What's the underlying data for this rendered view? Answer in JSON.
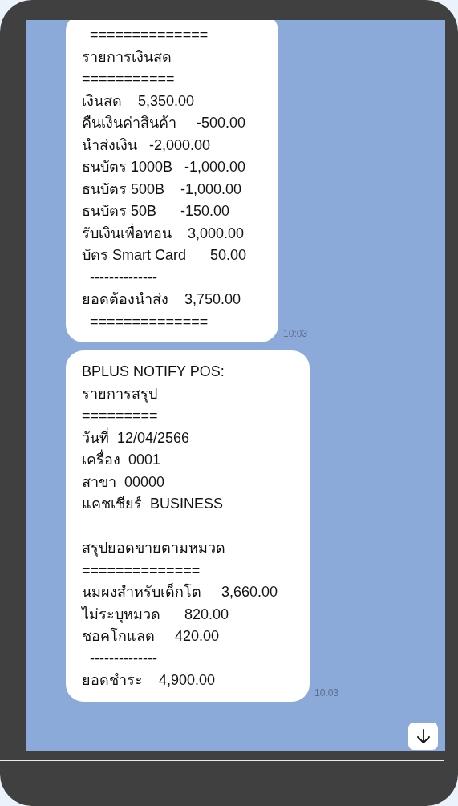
{
  "messages": [
    {
      "text": "  ==============\nรายการเงินสด\n===========\nเงินสด    5,350.00\nคืนเงินค่าสินค้า     -500.00\nนำส่งเงิน   -2,000.00\nธนบัตร 1000B   -1,000.00\nธนบัตร 500B    -1,000.00\nธนบัตร 50B      -150.00\nรับเงินเพื่อทอน    3,000.00\nบัตร Smart Card      50.00\n  --------------\nยอดต้องนำส่ง    3,750.00\n  ==============",
      "time": "10:03"
    },
    {
      "text": "BPLUS NOTIFY POS:\nรายการสรุป\n=========\nวันที่  12/04/2566\nเครื่อง  0001\nสาขา  00000\nแคชเชียร์  BUSINESS\n\nสรุปยอดขายตามหมวด\n==============\nนมผงสำหรับเด็กโต     3,660.00\nไม่ระบุหมวด      820.00\nชอคโกแลต     420.00\n  --------------\nยอดชำระ    4,900.00",
      "time": "10:03"
    }
  ]
}
